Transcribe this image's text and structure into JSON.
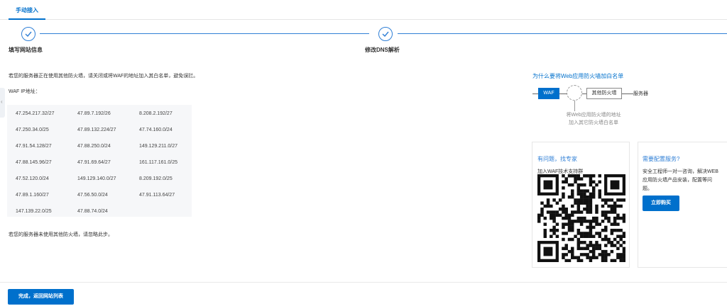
{
  "tabs": [
    {
      "label": "手动接入"
    }
  ],
  "steps": [
    {
      "title": "填写网站信息"
    },
    {
      "title": "修改DNS解析"
    }
  ],
  "instructions": {
    "firewall_note": "若您的服务器正在使用其他防火墙，请关闭或将WAF的地址加入其白名单，避免误拦。",
    "waf_ip_label": "WAF IP地址：",
    "no_firewall_note": "若您的服务器未使用其他防火墙，请忽略此步。"
  },
  "ip_list": [
    "47.254.217.32/27",
    "47.89.7.192/26",
    "8.208.2.192/27",
    "47.250.34.0/25",
    "47.89.132.224/27",
    "47.74.160.0/24",
    "47.91.54.128/27",
    "47.88.250.0/24",
    "149.129.211.0/27",
    "47.88.145.96/27",
    "47.91.69.64/27",
    "161.117.161.0/25",
    "47.52.120.0/24",
    "149.129.140.0/27",
    "8.209.192.0/25",
    "47.89.1.160/27",
    "47.56.50.0/24",
    "47.91.113.64/27",
    "147.139.22.0/25",
    "47.88.74.0/24"
  ],
  "diagram": {
    "title": "为什么要将Web应用防火墙加白名单",
    "waf_label": "WAF",
    "firewall_label": "其他防火墙",
    "server_label": "服务器",
    "note_line1": "将Web应用防火墙的地址",
    "note_line2": "加入其它防火墙白名单"
  },
  "expert_card": {
    "title": "有问题，找专家",
    "subtitle": "加入WAF技术支持群"
  },
  "service_card": {
    "title": "需要配置服务?",
    "desc_line1": "安全工程师一对一咨询，解决WEB",
    "desc_line2": "应用防火墙产品安装，配置等问",
    "desc_line3": "题。",
    "button_label": "立即购买"
  },
  "footer": {
    "done_label": "完成，返回网站列表"
  },
  "colors": {
    "primary": "#0070cc",
    "step_accent": "#2f7fd6"
  },
  "icons": [
    "check-icon",
    "chevron-left-icon",
    "qr-code-icon"
  ]
}
